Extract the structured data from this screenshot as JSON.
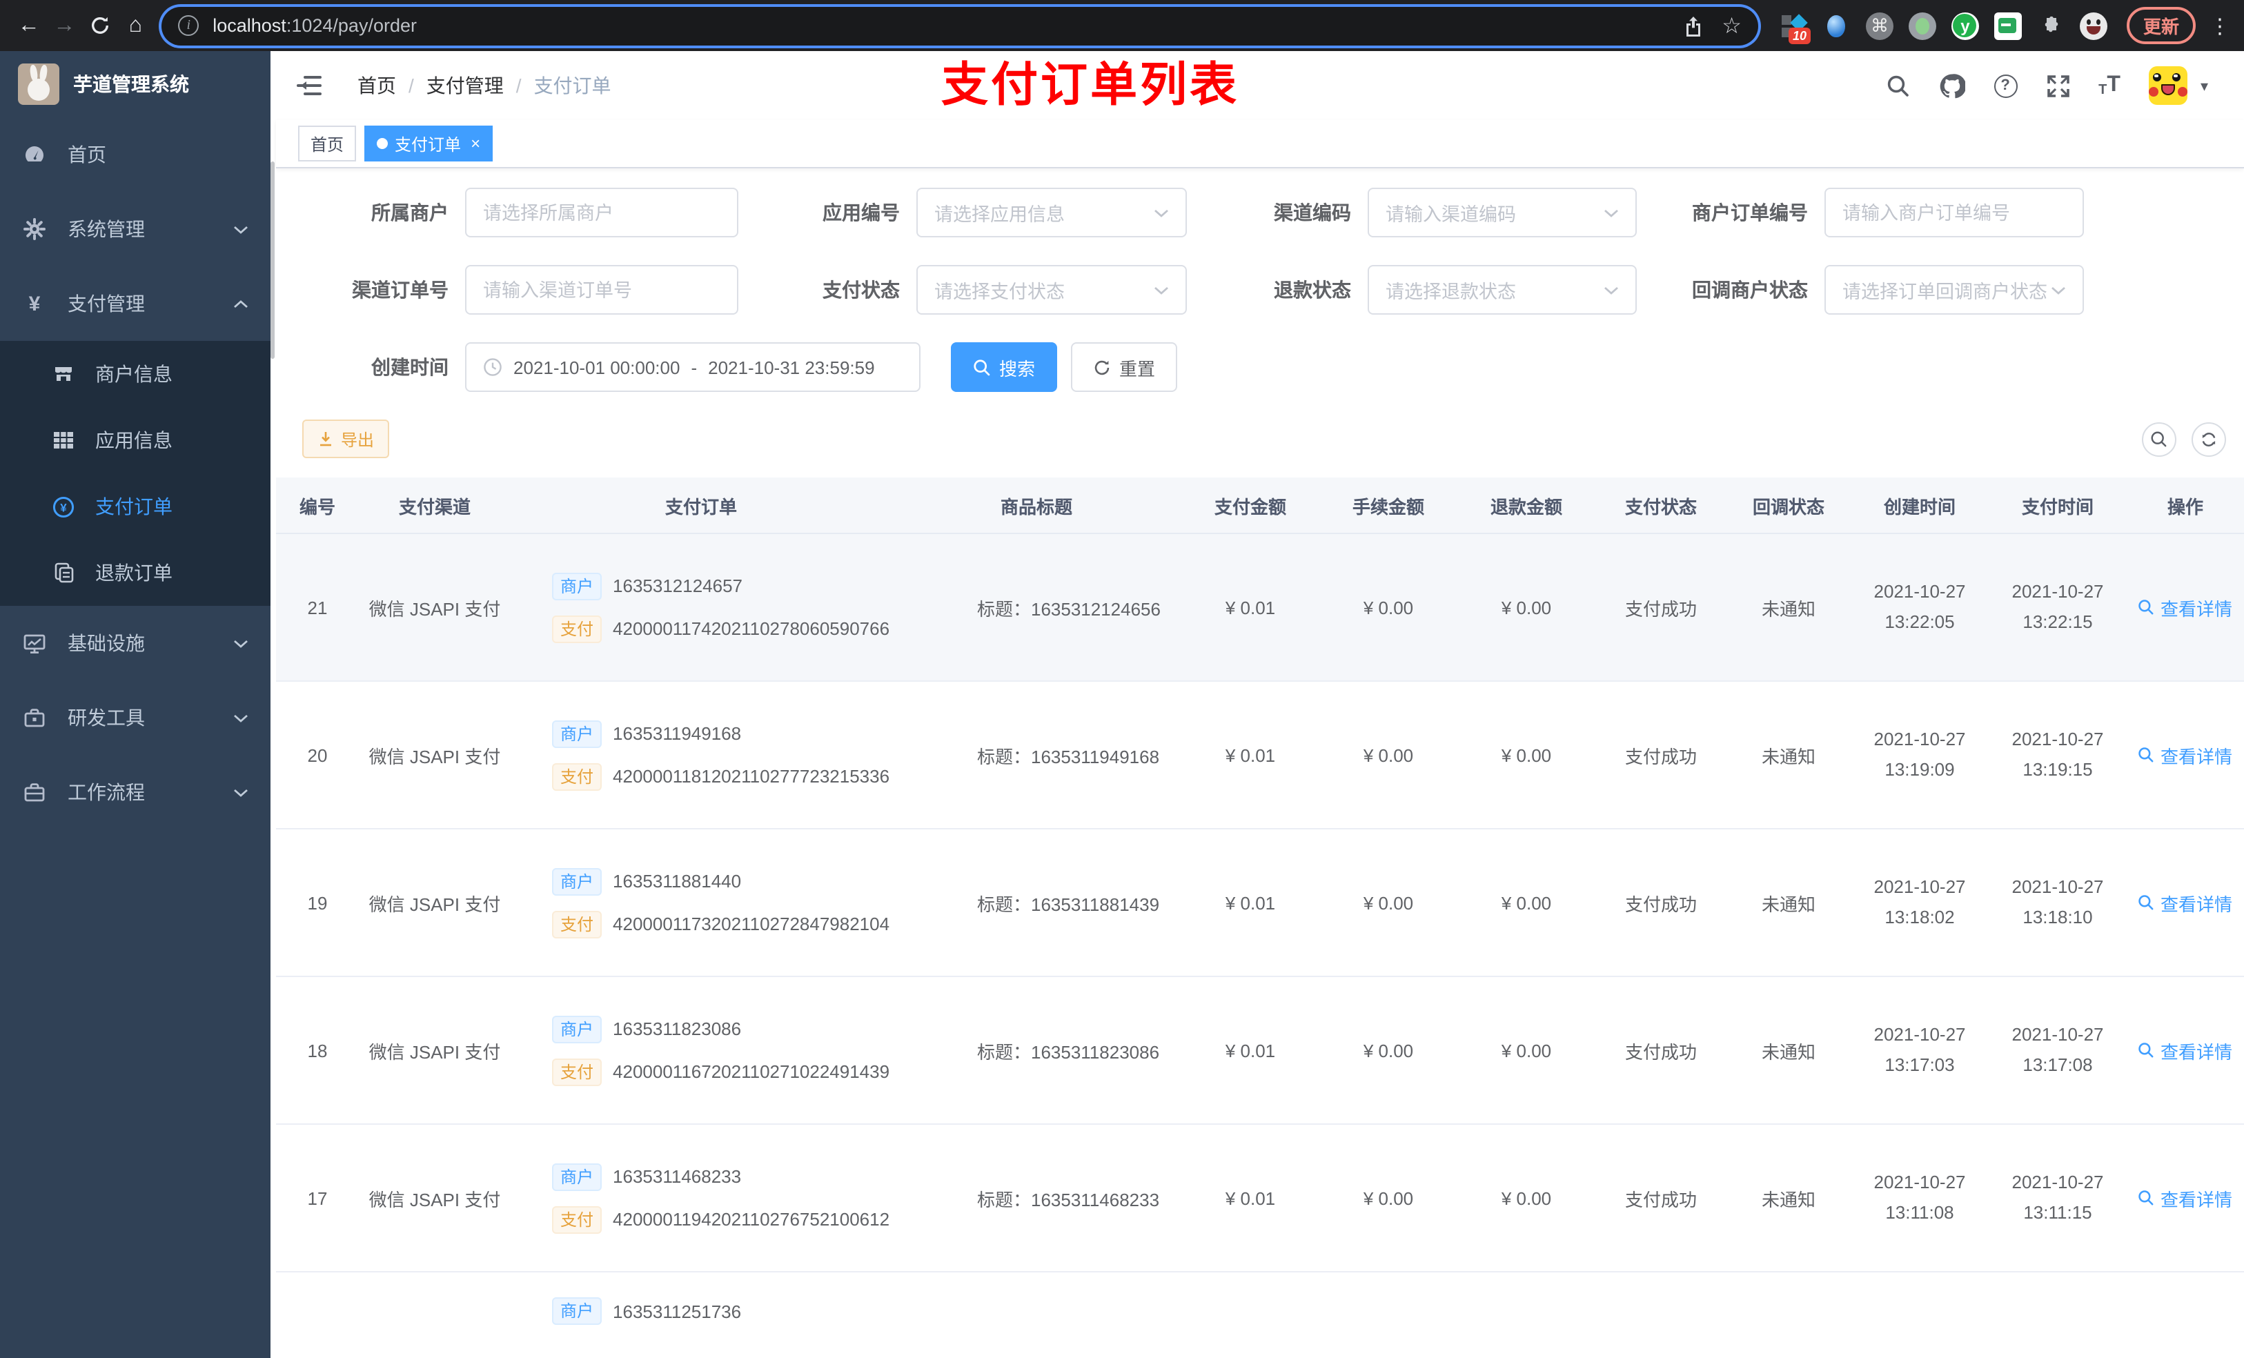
{
  "browser": {
    "url_host": "localhost",
    "url_rest": ":1024/pay/order",
    "extension_badge": "10",
    "ext_y_letter": "y",
    "update_label": "更新"
  },
  "sidebar": {
    "logo_title": "芋道管理系统",
    "items": {
      "home": "首页",
      "system": "系统管理",
      "pay": "支付管理",
      "merchant_info": "商户信息",
      "app_info": "应用信息",
      "pay_order": "支付订单",
      "refund_order": "退款订单",
      "infra": "基础设施",
      "dev_tools": "研发工具",
      "workflow": "工作流程"
    }
  },
  "navbar": {
    "breadcrumb": [
      "首页",
      "支付管理",
      "支付订单"
    ],
    "separator": "/",
    "annotation": "支付订单列表"
  },
  "tags_view": {
    "home": "首页",
    "active": "支付订单",
    "close": "×"
  },
  "filter": {
    "row1": [
      {
        "label": "所属商户",
        "placeholder": "请选择所属商户"
      },
      {
        "label": "应用编号",
        "placeholder": "请选择应用信息"
      },
      {
        "label": "渠道编码",
        "placeholder": "请输入渠道编码"
      },
      {
        "label": "商户订单编号",
        "placeholder": "请输入商户订单编号"
      }
    ],
    "row2": [
      {
        "label": "渠道订单号",
        "placeholder": "请输入渠道订单号"
      },
      {
        "label": "支付状态",
        "placeholder": "请选择支付状态"
      },
      {
        "label": "退款状态",
        "placeholder": "请选择退款状态"
      },
      {
        "label": "回调商户状态",
        "placeholder": "请选择订单回调商户状态"
      }
    ],
    "date_label": "创建时间",
    "date_start": "2021-10-01 00:00:00",
    "date_separator": "-",
    "date_end": "2021-10-31 23:59:59",
    "search_label": "搜索",
    "reset_label": "重置",
    "export_label": "导出"
  },
  "table": {
    "columns": [
      "编号",
      "支付渠道",
      "支付订单",
      "商品标题",
      "支付金额",
      "手续金额",
      "退款金额",
      "支付状态",
      "回调状态",
      "创建时间",
      "支付时间",
      "操作"
    ],
    "merchant_tag": "商户",
    "pay_tag": "支付",
    "action_label": "查看详情",
    "rows": [
      {
        "id": "21",
        "channel": "微信 JSAPI 支付",
        "merchant_no": "1635312124657",
        "pay_no": "4200001174202110278060590766",
        "title": "标题：1635312124656",
        "amount": "¥ 0.01",
        "fee": "¥ 0.00",
        "refund": "¥ 0.00",
        "status": "支付成功",
        "notify": "未通知",
        "created_date": "2021-10-27",
        "created_time": "13:22:05",
        "paid_date": "2021-10-27",
        "paid_time": "13:22:15"
      },
      {
        "id": "20",
        "channel": "微信 JSAPI 支付",
        "merchant_no": "1635311949168",
        "pay_no": "4200001181202110277723215336",
        "title": "标题：1635311949168",
        "amount": "¥ 0.01",
        "fee": "¥ 0.00",
        "refund": "¥ 0.00",
        "status": "支付成功",
        "notify": "未通知",
        "created_date": "2021-10-27",
        "created_time": "13:19:09",
        "paid_date": "2021-10-27",
        "paid_time": "13:19:15"
      },
      {
        "id": "19",
        "channel": "微信 JSAPI 支付",
        "merchant_no": "1635311881440",
        "pay_no": "4200001173202110272847982104",
        "title": "标题：1635311881439",
        "amount": "¥ 0.01",
        "fee": "¥ 0.00",
        "refund": "¥ 0.00",
        "status": "支付成功",
        "notify": "未通知",
        "created_date": "2021-10-27",
        "created_time": "13:18:02",
        "paid_date": "2021-10-27",
        "paid_time": "13:18:10"
      },
      {
        "id": "18",
        "channel": "微信 JSAPI 支付",
        "merchant_no": "1635311823086",
        "pay_no": "4200001167202110271022491439",
        "title": "标题：1635311823086",
        "amount": "¥ 0.01",
        "fee": "¥ 0.00",
        "refund": "¥ 0.00",
        "status": "支付成功",
        "notify": "未通知",
        "created_date": "2021-10-27",
        "created_time": "13:17:03",
        "paid_date": "2021-10-27",
        "paid_time": "13:17:08"
      },
      {
        "id": "17",
        "channel": "微信 JSAPI 支付",
        "merchant_no": "1635311468233",
        "pay_no": "4200001194202110276752100612",
        "title": "标题：1635311468233",
        "amount": "¥ 0.01",
        "fee": "¥ 0.00",
        "refund": "¥ 0.00",
        "status": "支付成功",
        "notify": "未通知",
        "created_date": "2021-10-27",
        "created_time": "13:11:08",
        "paid_date": "2021-10-27",
        "paid_time": "13:11:15"
      }
    ],
    "partial_row": {
      "merchant_no": "1635311251736"
    }
  }
}
